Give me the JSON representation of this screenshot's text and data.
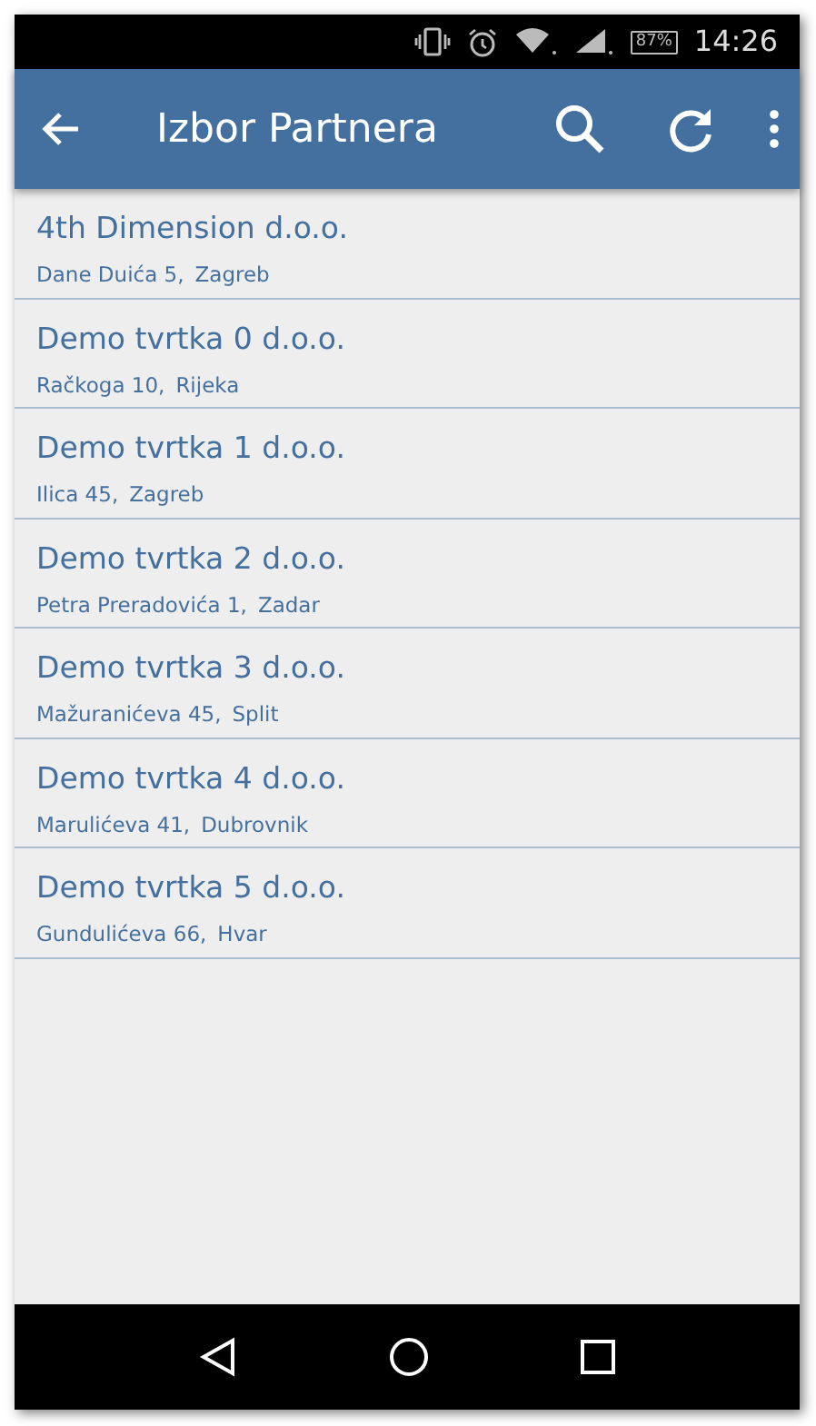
{
  "status_bar": {
    "battery": "87%",
    "time": "14:26"
  },
  "app_bar": {
    "title": "Izbor Partnera"
  },
  "partners": [
    {
      "name": "4th Dimension d.o.o.",
      "address": "Dane Duića 5,",
      "city": "Zagreb"
    },
    {
      "name": "Demo tvrtka 0 d.o.o.",
      "address": "Račkoga 10,",
      "city": "Rijeka"
    },
    {
      "name": "Demo tvrtka 1 d.o.o.",
      "address": "Ilica 45,",
      "city": "Zagreb"
    },
    {
      "name": "Demo tvrtka 2 d.o.o.",
      "address": "Petra Preradovića 1,",
      "city": "Zadar"
    },
    {
      "name": "Demo tvrtka 3 d.o.o.",
      "address": "Mažuranićeva 45,",
      "city": "Split"
    },
    {
      "name": "Demo tvrtka 4 d.o.o.",
      "address": "Marulićeva 41,",
      "city": "Dubrovnik"
    },
    {
      "name": "Demo tvrtka 5 d.o.o.",
      "address": "Gundulićeva 66,",
      "city": "Hvar"
    }
  ]
}
